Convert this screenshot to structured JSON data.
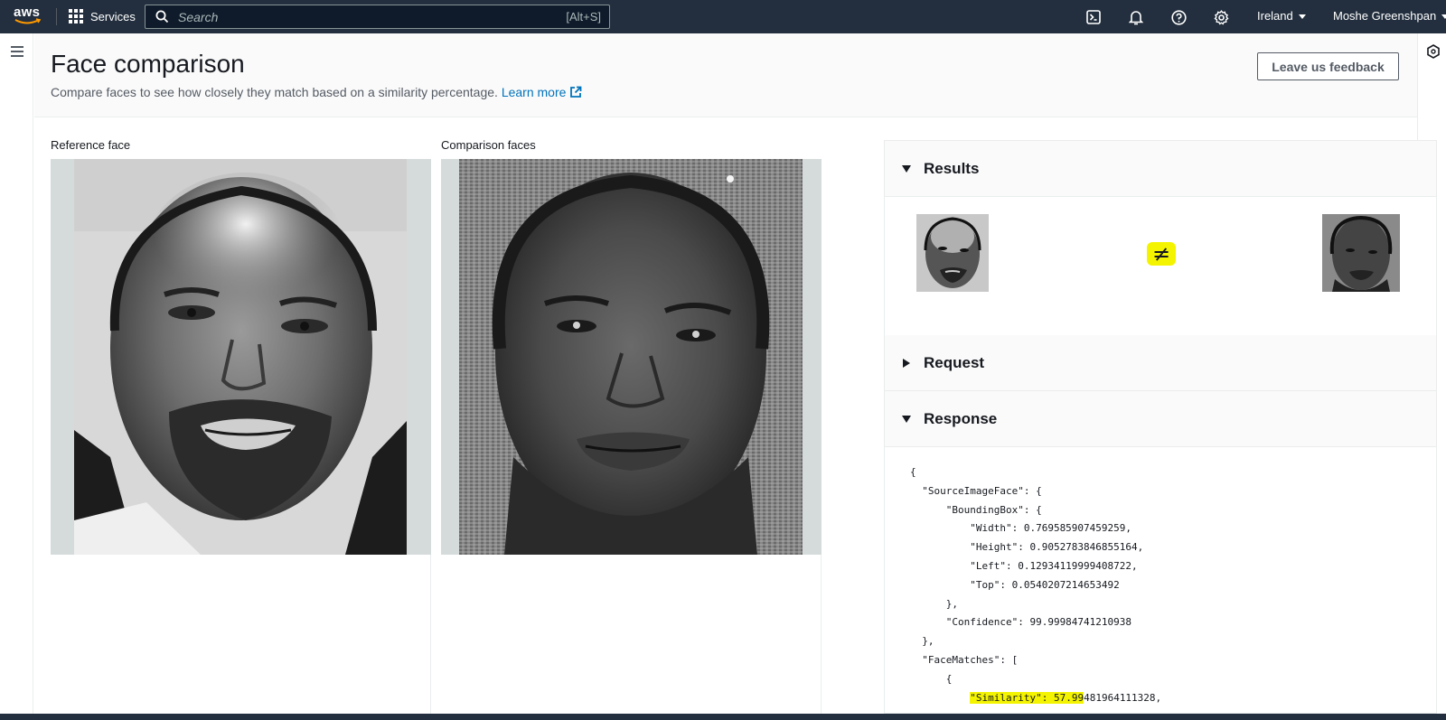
{
  "topnav": {
    "logo_text": "aws",
    "services_label": "Services",
    "search_placeholder": "Search",
    "search_shortcut": "[Alt+S]",
    "region": "Ireland",
    "user": "Moshe Greenshpan"
  },
  "header": {
    "title": "Face comparison",
    "description": "Compare faces to see how closely they match based on a similarity percentage.",
    "learn_more": "Learn more",
    "feedback_button": "Leave us feedback"
  },
  "images": {
    "reference_label": "Reference face",
    "comparison_label": "Comparison faces"
  },
  "results": {
    "results_title": "Results",
    "match_symbol": "≠",
    "request_title": "Request",
    "response_title": "Response",
    "response_lines": [
      "{",
      "  \"SourceImageFace\": {",
      "      \"BoundingBox\": {",
      "          \"Width\": 0.769585907459259,",
      "          \"Height\": 0.9052783846855164,",
      "          \"Left\": 0.12934119999408722,",
      "          \"Top\": 0.0540207214653492",
      "      },",
      "      \"Confidence\": 99.99984741210938",
      "  },",
      "  \"FaceMatches\": [",
      "      {"
    ],
    "similarity_key": "\"Similarity\": 57.99",
    "similarity_rest": "481964111328,"
  },
  "colors": {
    "nav_bg": "#232f3e",
    "link": "#0073bb",
    "highlight": "#f4f400"
  }
}
